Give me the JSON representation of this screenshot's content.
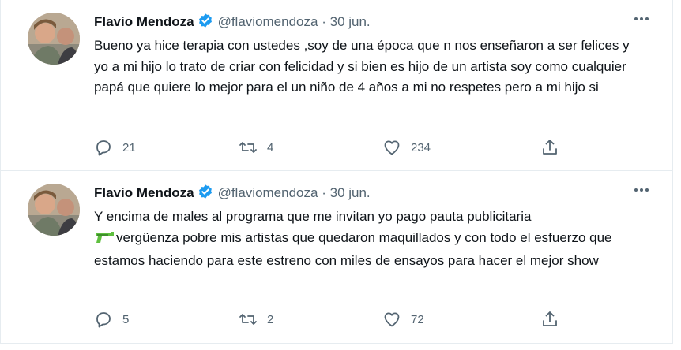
{
  "colors": {
    "verified": "#1d9bf0",
    "text": "#0f1419",
    "muted": "#536471",
    "border": "#e6ecf0"
  },
  "tweets": [
    {
      "name": "Flavio Mendoza",
      "handle": "@flaviomendoza",
      "separator": "·",
      "date": "30 jun.",
      "text": "Bueno ya hice terapia con ustedes ,soy de una época que n nos enseñaron a ser felices y yo a mi hijo lo trato de criar con felicidad y si bien es hijo de un artista soy como cualquier papá que quiere lo mejor para el un niño de 4 años a mi no respetes  pero a mi hijo si",
      "replies": "21",
      "retweets": "4",
      "likes": "234"
    },
    {
      "name": "Flavio Mendoza",
      "handle": "@flaviomendoza",
      "separator": "·",
      "date": "30 jun.",
      "text_line1": "Y encima de males al programa que me invitan yo pago pauta publicitaria",
      "text_rest": "vergüenza pobre mis artistas que quedaron maquillados y con todo el esfuerzo que estamos haciendo para este estreno con miles de ensayos para hacer el mejor show",
      "emoji": "water-pistol-icon",
      "replies": "5",
      "retweets": "2",
      "likes": "72"
    }
  ]
}
